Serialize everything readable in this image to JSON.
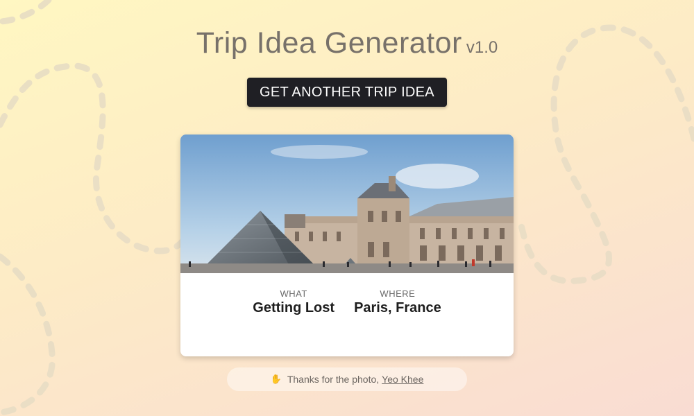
{
  "header": {
    "title": "Trip Idea Generator",
    "version": "v1.0"
  },
  "cta": {
    "label": "GET ANOTHER TRIP IDEA"
  },
  "idea": {
    "what_label": "WHAT",
    "what_value": "Getting Lost",
    "where_label": "WHERE",
    "where_value": "Paris, France"
  },
  "credit": {
    "text": "Thanks for the photo,",
    "author": "Yeo Khee",
    "icon": "clapping-hands-icon"
  },
  "colors": {
    "button_bg": "#1f1f24",
    "title_text": "#77716a",
    "trail": "#e6dcc4"
  }
}
